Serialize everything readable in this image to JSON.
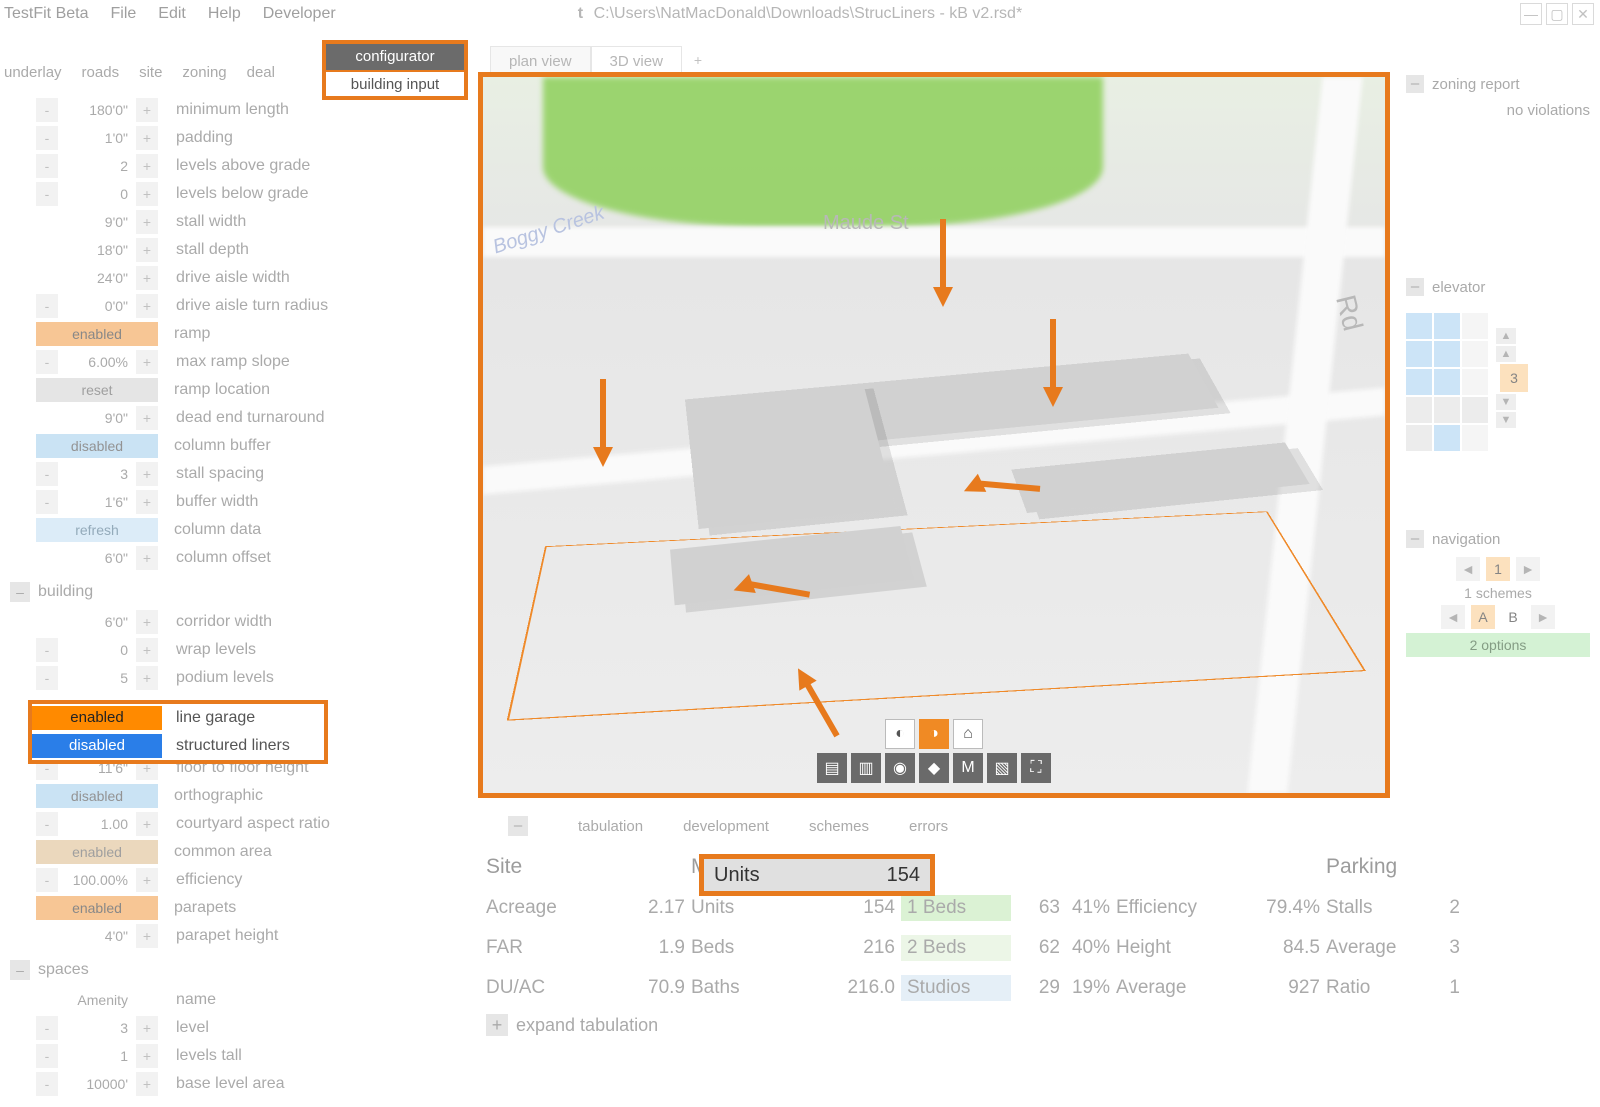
{
  "app": {
    "name": "TestFit Beta",
    "filepath": "C:\\Users\\NatMacDonald\\Downloads\\StrucLiners - kB v2.rsd*"
  },
  "menus": [
    "File",
    "Edit",
    "Help",
    "Developer"
  ],
  "side_tabs": [
    "underlay",
    "roads",
    "site",
    "zoning",
    "deal"
  ],
  "config_picker": {
    "top": "configurator",
    "bottom": "building input"
  },
  "view_tabs": {
    "plan": "plan view",
    "threeD": "3D view"
  },
  "props_top": [
    {
      "v": "180'0\"",
      "l": "minimum length",
      "pm": true
    },
    {
      "v": "1'0\"",
      "l": "padding",
      "pm": true
    },
    {
      "v": "2",
      "l": "levels above grade",
      "pm": true
    },
    {
      "v": "0",
      "l": "levels below grade",
      "pm": true
    },
    {
      "v": "9'0\"",
      "l": "stall width",
      "pm": true,
      "nominus": true
    },
    {
      "v": "18'0\"",
      "l": "stall depth",
      "pm": true,
      "nominus": true
    },
    {
      "v": "24'0\"",
      "l": "drive aisle width",
      "pm": true,
      "nominus": true
    },
    {
      "v": "0'0\"",
      "l": "drive aisle turn radius",
      "pm": true
    }
  ],
  "toggles1": [
    {
      "t": "enabled",
      "cls": "orange",
      "l": "ramp"
    }
  ],
  "props_mid": [
    {
      "v": "6.00%",
      "l": "max ramp slope",
      "pm": true
    }
  ],
  "toggles2": [
    {
      "t": "reset",
      "cls": "gray",
      "l": "ramp location"
    }
  ],
  "props_mid2": [
    {
      "v": "9'0\"",
      "l": "dead end turnaround",
      "pm": true,
      "nominus": true
    }
  ],
  "toggles3": [
    {
      "t": "disabled",
      "cls": "blue",
      "l": "column buffer"
    }
  ],
  "props_mid3": [
    {
      "v": "3",
      "l": "stall spacing",
      "pm": true
    },
    {
      "v": "1'6\"",
      "l": "buffer width",
      "pm": true
    }
  ],
  "toggles4": [
    {
      "t": "refresh",
      "cls": "refresh",
      "l": "column data"
    }
  ],
  "props_mid4": [
    {
      "v": "6'0\"",
      "l": "column offset",
      "pm": true,
      "nominus": true
    }
  ],
  "section_building": "building",
  "props_bld": [
    {
      "v": "6'0\"",
      "l": "corridor width",
      "pm": true,
      "nominus": true
    },
    {
      "v": "0",
      "l": "wrap levels",
      "pm": true
    },
    {
      "v": "5",
      "l": "podium levels",
      "pm": true
    }
  ],
  "liners": {
    "enabled": "enabled",
    "enabled_l": "line garage",
    "disabled": "disabled",
    "disabled_l": "structured liners"
  },
  "props_bld2": [
    {
      "v": "11'6\"",
      "l": "floor to floor height",
      "pm": true
    }
  ],
  "toggles5": [
    {
      "t": "disabled",
      "cls": "blue",
      "l": "orthographic"
    }
  ],
  "props_bld3": [
    {
      "v": "1.00",
      "l": "courtyard aspect ratio",
      "pm": true
    }
  ],
  "toggles6": [
    {
      "t": "enabled",
      "cls": "tan",
      "l": "common area"
    }
  ],
  "props_bld4": [
    {
      "v": "100.00%",
      "l": "efficiency",
      "pm": true
    }
  ],
  "toggles7": [
    {
      "t": "enabled",
      "cls": "orange",
      "l": "parapets"
    }
  ],
  "props_bld5": [
    {
      "v": "4'0\"",
      "l": "parapet height",
      "pm": true,
      "nominus": true
    }
  ],
  "section_spaces": "spaces",
  "spaces_hdr": {
    "v": "Amenity",
    "l": "name"
  },
  "props_sp": [
    {
      "v": "3",
      "l": "level",
      "pm": true
    },
    {
      "v": "1",
      "l": "levels tall",
      "pm": true
    },
    {
      "v": "10000'",
      "l": "base level area",
      "pm": true
    }
  ],
  "right": {
    "zoning": {
      "title": "zoning report",
      "body": "no violations"
    },
    "elevator": {
      "title": "elevator",
      "level": "3"
    },
    "navigation": {
      "title": "navigation",
      "schemes_n": "1",
      "schemes_l": "1 schemes",
      "a": "A",
      "b": "B",
      "options": "2 options"
    }
  },
  "viewport": {
    "streets": {
      "maude": "Maude St",
      "creek": "Boggy Creek",
      "rd": "Rd"
    }
  },
  "bottom": {
    "tabs": [
      "tabulation",
      "development",
      "schemes",
      "errors"
    ],
    "hdr": {
      "site": "Site",
      "multi": "Multifamily",
      "parking": "Parking"
    },
    "units_box": {
      "label": "Units",
      "value": "154"
    },
    "rows": [
      {
        "c1": "Acreage",
        "c2": "2.17",
        "c3": "Units",
        "c4": "154",
        "c5": "1 Beds",
        "c6": "63",
        "c7": "41%",
        "c8": "Efficiency",
        "c9": "79.4%",
        "c10": "Stalls",
        "c11": "2"
      },
      {
        "c1": "FAR",
        "c2": "1.9",
        "c3": "Beds",
        "c4": "216",
        "c5": "2 Beds",
        "c6": "62",
        "c7": "40%",
        "c8": "Height",
        "c9": "84.5",
        "c10": "Average",
        "c11": "3"
      },
      {
        "c1": "DU/AC",
        "c2": "70.9",
        "c3": "Baths",
        "c4": "216.0",
        "c5": "Studios",
        "c6": "29",
        "c7": "19%",
        "c8": "Average",
        "c9": "927",
        "c10": "Ratio",
        "c11": "1"
      }
    ],
    "expand": "expand tabulation"
  }
}
